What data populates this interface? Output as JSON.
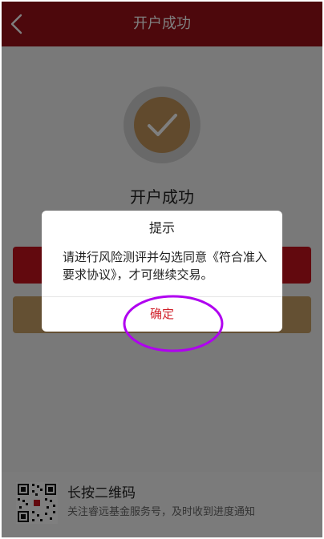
{
  "header": {
    "title": "开户成功",
    "back_icon": "chevron-left-icon"
  },
  "success": {
    "icon": "checkmark-icon",
    "title": "开户成功"
  },
  "buttons": {
    "primary_label": "",
    "secondary_label": ""
  },
  "footer": {
    "qr_icon": "qr-code-icon",
    "title": "长按二维码",
    "subtitle": "关注睿远基金服务号，及时收到进度通知"
  },
  "modal": {
    "title": "提示",
    "message": "请进行风险测评并勾选同意《符合准入要求协议》，才可继续交易。",
    "confirm_label": "确定"
  },
  "colors": {
    "header_bg": "#9b1018",
    "primary": "#c4121d",
    "gold": "#c9a066",
    "confirm_text": "#d0212b",
    "annotation": "#b000f0"
  }
}
